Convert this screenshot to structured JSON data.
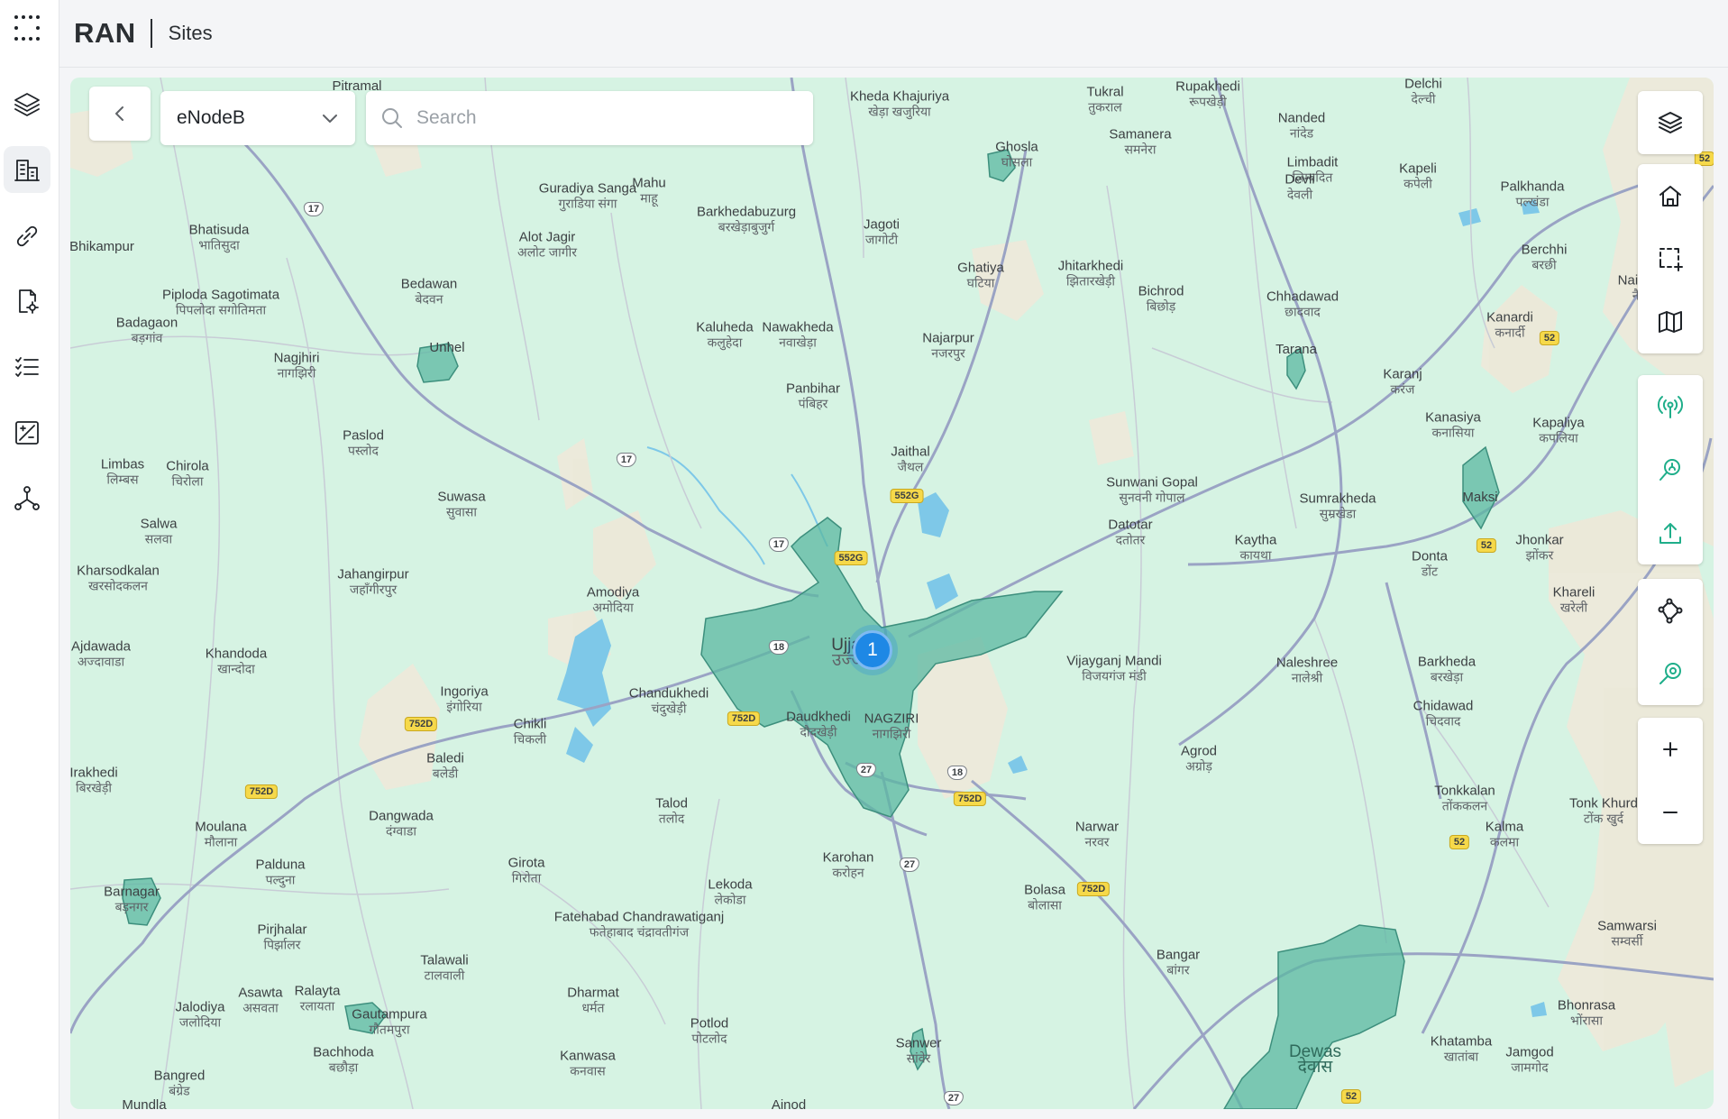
{
  "app": {
    "title": "RAN",
    "page": "Sites"
  },
  "rail": {
    "items": [
      {
        "icon": "grid-menu-icon"
      },
      {
        "icon": "layers-icon"
      },
      {
        "icon": "building-icon",
        "active": true
      },
      {
        "icon": "link-icon"
      },
      {
        "icon": "document-settings-icon"
      },
      {
        "icon": "checklist-icon"
      },
      {
        "icon": "chart-analytics-icon"
      },
      {
        "icon": "topology-icon"
      }
    ]
  },
  "toolbar": {
    "type_select": "eNodeB",
    "search_placeholder": "Search"
  },
  "map_tools": [
    {
      "icon": "layers-icon"
    },
    {
      "icon": "home-icon"
    },
    {
      "icon": "box-select-icon"
    },
    {
      "icon": "map-icon"
    },
    {
      "icon": "antenna-icon"
    },
    {
      "icon": "site-search-icon"
    },
    {
      "icon": "upload-icon"
    },
    {
      "icon": "route-icon"
    },
    {
      "icon": "coverage-icon"
    },
    {
      "icon": "zoom-in-icon",
      "label": "+"
    },
    {
      "icon": "zoom-out-icon",
      "label": "−"
    }
  ],
  "cluster": {
    "count": "1"
  },
  "places": [
    {
      "en": "Pitramal",
      "hi": ""
    },
    {
      "en": "Kheda Khajuriya",
      "hi": "खेड़ा खजुरिया"
    },
    {
      "en": "Tukral",
      "hi": "तुकराल"
    },
    {
      "en": "Rupakhedi",
      "hi": "रूपखेड़ी"
    },
    {
      "en": "Delchi",
      "hi": "देल्ची"
    },
    {
      "en": "Nanded",
      "hi": "नांदेड"
    },
    {
      "en": "Samanera",
      "hi": "समनेरा"
    },
    {
      "en": "Ghosla",
      "hi": "घोसला"
    },
    {
      "en": "Limbadit",
      "hi": "लिम्बदित"
    },
    {
      "en": "Kapeli",
      "hi": "कपेली"
    },
    {
      "en": "Devli",
      "hi": "देवली"
    },
    {
      "en": "Palkhanda",
      "hi": "पल्खंडा"
    },
    {
      "en": "Guradiya Sanga",
      "hi": "गुराडिया संगा"
    },
    {
      "en": "Mahu",
      "hi": "माहू"
    },
    {
      "en": "Barkhedabuzurg",
      "hi": "बरखेड़ाबुजुर्ग"
    },
    {
      "en": "Jagoti",
      "hi": "जागोटी"
    },
    {
      "en": "Bhatisuda",
      "hi": "भातिसुदा"
    },
    {
      "en": "Bhikampur",
      "hi": "भीकमपुर"
    },
    {
      "en": "Alot Jagir",
      "hi": "अलोट जागीर"
    },
    {
      "en": "Ghatiya",
      "hi": "घटिया"
    },
    {
      "en": "Jhitarkhedi",
      "hi": "झितारखेड़ी"
    },
    {
      "en": "Berchhi",
      "hi": "बरछी"
    },
    {
      "en": "Piploda Sagotimata",
      "hi": "पिपलोदा सगोतिमता"
    },
    {
      "en": "Bedawan",
      "hi": "बेदवन"
    },
    {
      "en": "Bichrod",
      "hi": "बिछोड़"
    },
    {
      "en": "Chhadawad",
      "hi": "छादवाद"
    },
    {
      "en": "Nainawad",
      "hi": "नैनावद"
    },
    {
      "en": "Badagaon",
      "hi": "बड़गांव"
    },
    {
      "en": "Kaluheda",
      "hi": "कलुहेदा"
    },
    {
      "en": "Nawakheda",
      "hi": "नवाखेड़ा"
    },
    {
      "en": "Kanardi",
      "hi": "कनार्दी"
    },
    {
      "en": "Unhel",
      "hi": "उन्हेल"
    },
    {
      "en": "Najarpur",
      "hi": "नजरपुर"
    },
    {
      "en": "Tarana",
      "hi": "तराना"
    },
    {
      "en": "Nagjhiri",
      "hi": "नागझिरी"
    },
    {
      "en": "Karanj",
      "hi": "करंज"
    },
    {
      "en": "Panbihar",
      "hi": "पंबिहर"
    },
    {
      "en": "Kanasiya",
      "hi": "कनासिया"
    },
    {
      "en": "Kapaliya",
      "hi": "कपलिया"
    },
    {
      "en": "Paslod",
      "hi": "पस्लोद"
    },
    {
      "en": "Jaithal",
      "hi": "जैथल"
    },
    {
      "en": "Limbas",
      "hi": "लिम्बस"
    },
    {
      "en": "Chirola",
      "hi": "चिरोला"
    },
    {
      "en": "Sunwani Gopal",
      "hi": "सुनवनी गोपाल"
    },
    {
      "en": "Sumrakheda",
      "hi": "सुम्रखेडा"
    },
    {
      "en": "Suwasa",
      "hi": "सुवासा"
    },
    {
      "en": "Maksi",
      "hi": "मक्सी"
    },
    {
      "en": "Salwa",
      "hi": "सलवा"
    },
    {
      "en": "Datotar",
      "hi": "दतोतर"
    },
    {
      "en": "Kaytha",
      "hi": "कायथा"
    },
    {
      "en": "Jhonkar",
      "hi": "झोंकर"
    },
    {
      "en": "Donta",
      "hi": "डोंट"
    },
    {
      "en": "Kharsodkalan",
      "hi": "खरसोदकलन"
    },
    {
      "en": "Jahangirpur",
      "hi": "जहाँगीरपुर"
    },
    {
      "en": "Khareli",
      "hi": "खरेली"
    },
    {
      "en": "Amodiya",
      "hi": "अमोदिया"
    },
    {
      "en": "Ajdawada",
      "hi": "अज्दावाडा"
    },
    {
      "en": "Khandoda",
      "hi": "खान्दोदा"
    },
    {
      "en": "Vijayganj Mandi",
      "hi": "विजयगंज मंडी"
    },
    {
      "en": "Naleshree",
      "hi": "नालेश्री"
    },
    {
      "en": "Barkheda",
      "hi": "बरखेड़ा"
    },
    {
      "en": "Ingoriya",
      "hi": "इंगोरिया"
    },
    {
      "en": "Chandukhedi",
      "hi": "चंदुखेड़ी"
    },
    {
      "en": "Chidawad",
      "hi": "चिदवाद"
    },
    {
      "en": "Chikli",
      "hi": "चिकली"
    },
    {
      "en": "Daudkhedi",
      "hi": "दौदखेड़ी"
    },
    {
      "en": "NAGZIRI",
      "hi": "नागझिरी"
    },
    {
      "en": "Irakhedi",
      "hi": "बिरखेड़ी"
    },
    {
      "en": "Baledi",
      "hi": "बलेडी"
    },
    {
      "en": "Agrod",
      "hi": "अग्रोड़"
    },
    {
      "en": "Tonkkalan",
      "hi": "तोंककलन"
    },
    {
      "en": "Tonk Khurd",
      "hi": "टोंक खुर्द"
    },
    {
      "en": "Talod",
      "hi": "तलोद"
    },
    {
      "en": "Dangwada",
      "hi": "दंग्वाडा"
    },
    {
      "en": "Moulana",
      "hi": "मौलाना"
    },
    {
      "en": "Narwar",
      "hi": "नरवर"
    },
    {
      "en": "Kalma",
      "hi": "कलमा"
    },
    {
      "en": "Karohan",
      "hi": "करोहन"
    },
    {
      "en": "Palduna",
      "hi": "पल्दुना"
    },
    {
      "en": "Girota",
      "hi": "गिरोता"
    },
    {
      "en": "Bolasa",
      "hi": "बोलासा"
    },
    {
      "en": "Lekoda",
      "hi": "लेकोडा"
    },
    {
      "en": "Barnagar",
      "hi": "बड़नगर"
    },
    {
      "en": "Fatehabad Chandrawatiganj",
      "hi": "फतेहाबाद चंद्रावतीगंज"
    },
    {
      "en": "Samwarsi",
      "hi": "सम्वर्सी"
    },
    {
      "en": "Pirjhalar",
      "hi": "पिर्झालर"
    },
    {
      "en": "Bangar",
      "hi": "बांगर"
    },
    {
      "en": "Talawali",
      "hi": "टालवाली"
    },
    {
      "en": "Ralayta",
      "hi": "रलायता"
    },
    {
      "en": "Asawta",
      "hi": "असवता"
    },
    {
      "en": "Jalodiya",
      "hi": "जलोदिया"
    },
    {
      "en": "Dharmat",
      "hi": "धर्मत"
    },
    {
      "en": "Bhonrasa",
      "hi": "भोंरासा"
    },
    {
      "en": "Gautampura",
      "hi": "गौतमपुरा"
    },
    {
      "en": "Potlod",
      "hi": "पोटलोद"
    },
    {
      "en": "Khatamba",
      "hi": "खातांबा"
    },
    {
      "en": "Jamgod",
      "hi": "जामगोद"
    },
    {
      "en": "Sanwer",
      "hi": "सांवेर"
    },
    {
      "en": "Dewas",
      "hi": "देवास"
    },
    {
      "en": "Bachhoda",
      "hi": "बछौड़ा"
    },
    {
      "en": "Kanwasa",
      "hi": "कनवास"
    },
    {
      "en": "Bangred",
      "hi": "बंग्रेड"
    },
    {
      "en": "Ajnod",
      "hi": ""
    },
    {
      "en": "Mundla",
      "hi": ""
    },
    {
      "en": "Ujjain",
      "hi": "उज्जैन"
    }
  ],
  "shields": [
    "552G",
    "552G",
    "752D",
    "752D",
    "752D",
    "752D",
    "752D",
    "52",
    "52",
    "52",
    "52",
    "52"
  ],
  "nh_shields": [
    "17",
    "17",
    "17",
    "18",
    "18",
    "27",
    "27",
    "27"
  ]
}
